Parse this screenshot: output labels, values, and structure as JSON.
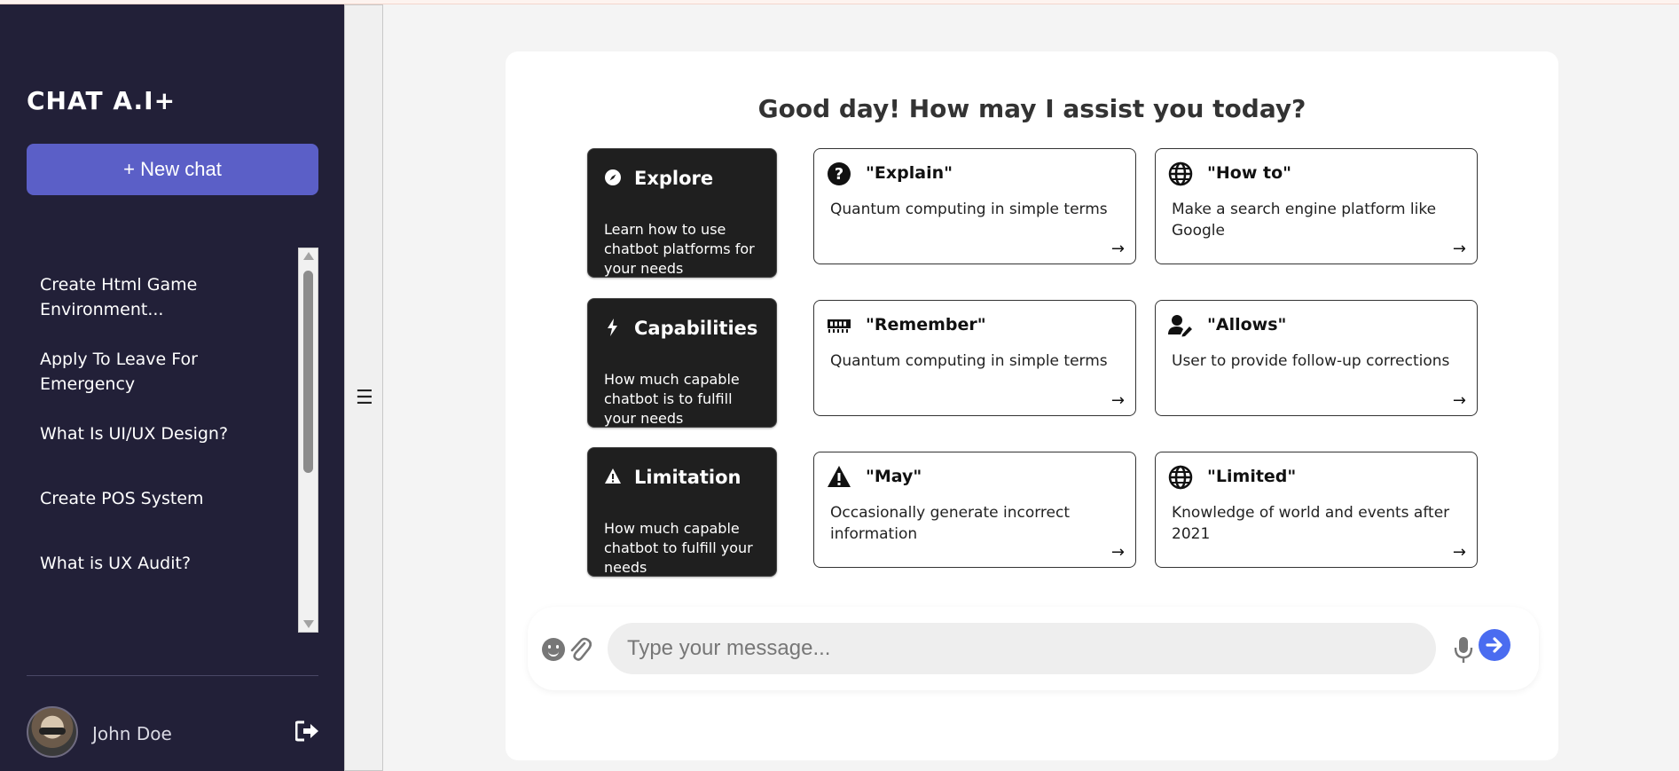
{
  "sidebar": {
    "brand": "CHAT A.I+",
    "new_chat_label": "+ New chat",
    "history": [
      {
        "label": "Create Html Game Environment..."
      },
      {
        "label": "Apply To Leave For Emergency"
      },
      {
        "label": "What Is UI/UX Design?"
      },
      {
        "label": "Create POS System"
      },
      {
        "label": "What is UX Audit?"
      }
    ],
    "user": {
      "name": "John Doe"
    },
    "toggle_glyph": "☰"
  },
  "main": {
    "greeting": "Good day! How may I assist you today?",
    "categories": [
      {
        "title": "Explore",
        "description": "Learn how to use chatbot platforms for your needs",
        "icon": "compass-icon"
      },
      {
        "title": "Capabilities",
        "description": "How much capable chatbot is to fulfill your needs",
        "icon": "bolt-icon"
      },
      {
        "title": "Limitation",
        "description": "How much capable chatbot to fulfill your needs",
        "icon": "warning-icon"
      }
    ],
    "cards": [
      {
        "title": "\"Explain\"",
        "description": "Quantum computing in simple terms",
        "icon": "question-circle-icon"
      },
      {
        "title": "\"How to\"",
        "description": "Make a search engine platform like Google",
        "icon": "globe-icon"
      },
      {
        "title": "\"Remember\"",
        "description": "Quantum computing in simple terms",
        "icon": "memory-icon"
      },
      {
        "title": "\"Allows\"",
        "description": "User to provide follow-up corrections",
        "icon": "user-edit-icon"
      },
      {
        "title": "\"May\"",
        "description": "Occasionally generate incorrect information",
        "icon": "warning-icon"
      },
      {
        "title": "\"Limited\"",
        "description": "Knowledge of world and events after 2021",
        "icon": "globe-icon"
      }
    ],
    "arrow_glyph": "→"
  },
  "composer": {
    "placeholder": "Type your message..."
  },
  "colors": {
    "sidebar_bg": "#222038",
    "accent": "#5b5fc7",
    "send_button": "#4a6cf0",
    "dark_card": "#1f1f1f"
  }
}
